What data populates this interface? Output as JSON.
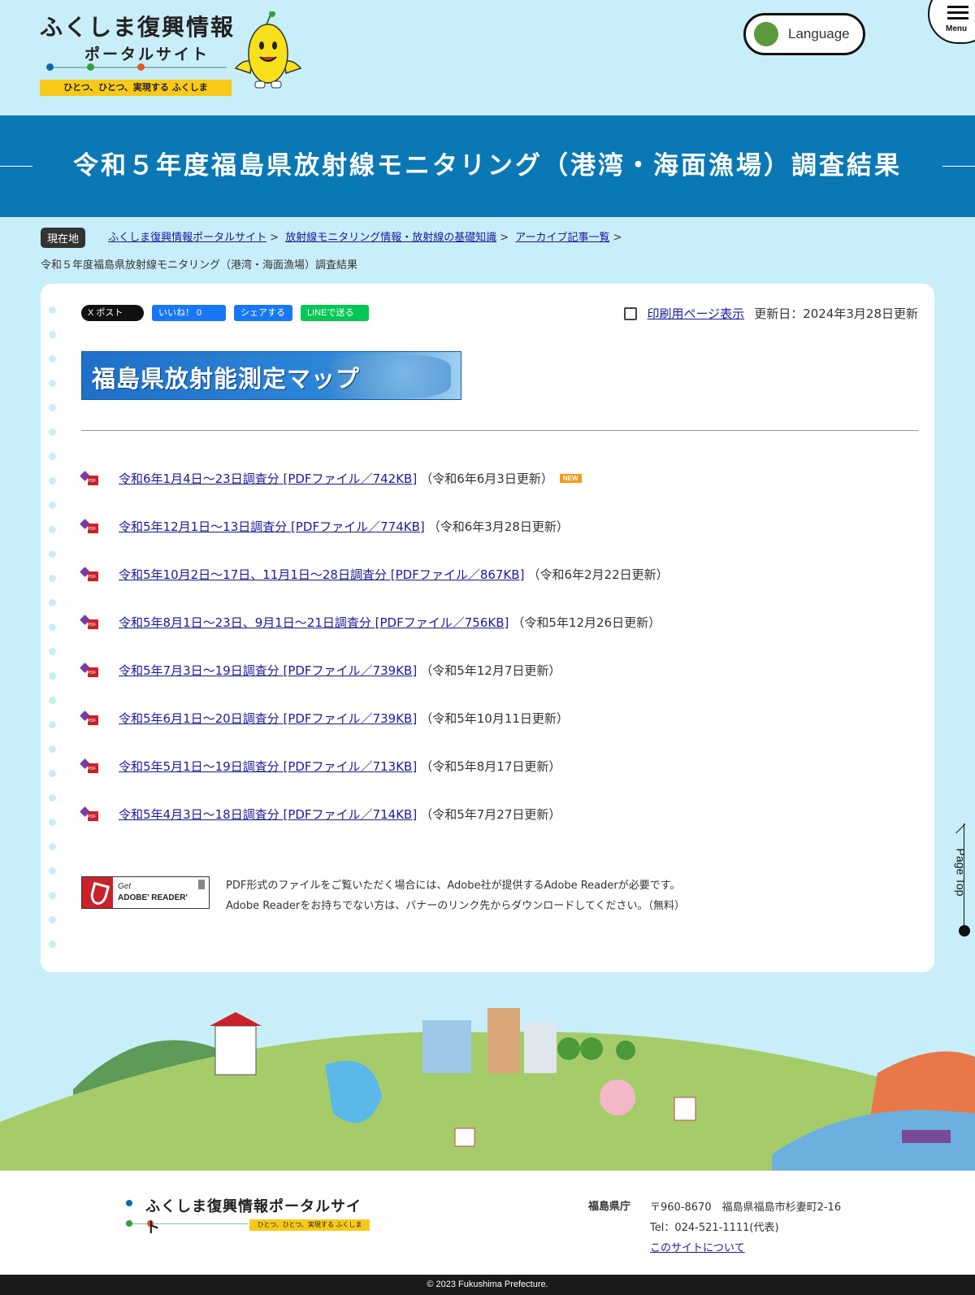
{
  "header": {
    "logo_title": "ふくしま復興情報",
    "logo_subtitle": "ポータルサイト",
    "logo_tagline": "ひとつ、ひとつ、実現する ふくしま",
    "language_label": "Language",
    "menu_label": "Menu"
  },
  "page": {
    "title": "令和５年度福島県放射線モニタリング（港湾・海面漁場）調査結果"
  },
  "breadcrumb": {
    "here_label": "現在地",
    "items": [
      "ふくしま復興情報ポータルサイト",
      "放射線モニタリング情報・放射線の基礎知識",
      "アーカイブ記事一覧"
    ],
    "separator": ">",
    "current": "令和５年度福島県放射線モニタリング（港湾・海面漁場）調査結果"
  },
  "social": {
    "x_label": "X ポスト",
    "fb_label": "いいね！ 0",
    "share_label": "シェアする",
    "line_label": "LINEで送る"
  },
  "tools": {
    "print_label": "印刷用ページ表示",
    "updated": "更新日：2024年3月28日更新"
  },
  "banner": {
    "text": "福島県放射能測定マップ"
  },
  "files": [
    {
      "link": "令和6年1月4日～23日調査分 [PDFファイル／742KB]",
      "note": "（令和6年6月3日更新）",
      "new": "NEW"
    },
    {
      "link": "令和5年12月1日～13日調査分 [PDFファイル／774KB]",
      "note": "（令和6年3月28日更新）"
    },
    {
      "link": "令和5年10月2日～17日、11月1日～28日調査分 [PDFファイル／867KB]",
      "note": "（令和6年2月22日更新）"
    },
    {
      "link": "令和5年8月1日～23日、9月1日～21日調査分 [PDFファイル／756KB]",
      "note": "（令和5年12月26日更新）"
    },
    {
      "link": "令和5年7月3日～19日調査分 [PDFファイル／739KB]",
      "note": "（令和5年12月7日更新）"
    },
    {
      "link": "令和5年6月1日～20日調査分 [PDFファイル／739KB]",
      "note": "（令和5年10月11日更新）"
    },
    {
      "link": "令和5年5月1日～19日調査分 [PDFファイル／713KB]",
      "note": "（令和5年8月17日更新）"
    },
    {
      "link": "令和5年4月3日～18日調査分 [PDFファイル／714KB]",
      "note": "（令和5年7月27日更新）"
    }
  ],
  "adobe": {
    "get": "Get",
    "name": "ADOBE' READER'",
    "note_line1": "PDF形式のファイルをご覧いただく場合には、Adobe社が提供するAdobe Readerが必要です。",
    "note_line2": "Adobe Readerをお持ちでない方は、バナーのリンク先からダウンロードしてください。（無料）"
  },
  "page_top": {
    "label": "Page Top"
  },
  "footer": {
    "logo_title": "ふくしま復興情報ポータルサイト",
    "logo_tagline": "ひとつ、ひとつ、実現する ふくしま",
    "org": "福島県庁",
    "address": "〒960-8670　福島県福島市杉妻町2-16",
    "tel": "Tel：024-521-1111(代表)",
    "about_link": "このサイトについて",
    "copyright": "© 2023 Fukushima Prefecture."
  },
  "colors": {
    "sky": "#c8eef9",
    "title_band": "#0a78b5",
    "link": "#1a1a9a",
    "accent_yellow": "#f8c918"
  }
}
